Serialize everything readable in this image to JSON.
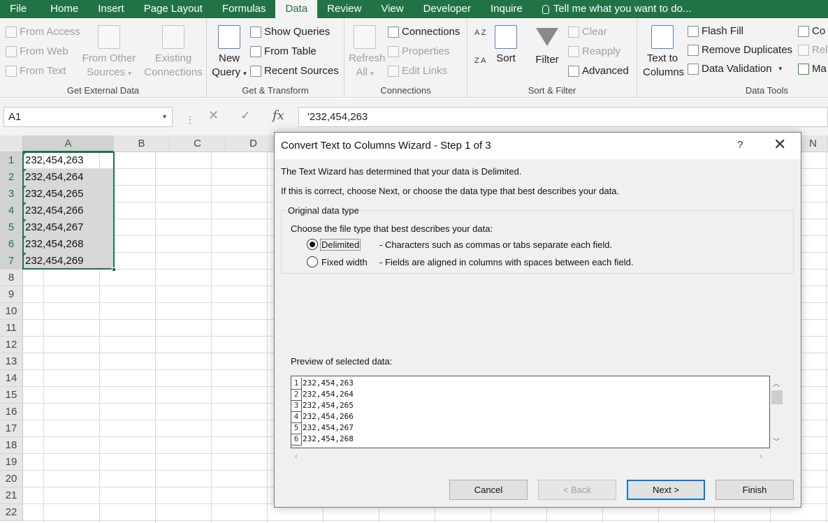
{
  "menu": {
    "items": [
      "File",
      "Home",
      "Insert",
      "Page Layout",
      "Formulas",
      "Data",
      "Review",
      "View",
      "Developer",
      "Inquire"
    ],
    "active": "Data",
    "tell_me": "Tell me what you want to do..."
  },
  "ribbon": {
    "get_external_data": {
      "label": "Get External Data",
      "from_access": "From Access",
      "from_web": "From Web",
      "from_text": "From Text",
      "from_other_sources_1": "From Other",
      "from_other_sources_2": "Sources",
      "existing_connections_1": "Existing",
      "existing_connections_2": "Connections"
    },
    "get_transform": {
      "label": "Get & Transform",
      "new_query_1": "New",
      "new_query_2": "Query",
      "show_queries": "Show Queries",
      "from_table": "From Table",
      "recent_sources": "Recent Sources"
    },
    "connections": {
      "label": "Connections",
      "refresh_1": "Refresh",
      "refresh_2": "All",
      "connections": "Connections",
      "properties": "Properties",
      "edit_links": "Edit Links"
    },
    "sort_filter": {
      "label": "Sort & Filter",
      "sort": "Sort",
      "filter": "Filter",
      "clear": "Clear",
      "reapply": "Reapply",
      "advanced": "Advanced",
      "az_icon": "A Z",
      "za_icon": "Z A"
    },
    "data_tools": {
      "label": "Data Tools",
      "text_to_columns_1": "Text to",
      "text_to_columns_2": "Columns",
      "flash_fill": "Flash Fill",
      "remove_duplicates": "Remove Duplicates",
      "data_validation": "Data Validation",
      "consolidate_partial": "Co",
      "relationships_partial": "Rel",
      "manage_partial": "Ma"
    }
  },
  "formula_bar": {
    "name_box": "A1",
    "fx": "fx",
    "content": "'232,454,263"
  },
  "sheet": {
    "columns": [
      "A",
      "B",
      "C",
      "D",
      "N"
    ],
    "rows": [
      "1",
      "2",
      "3",
      "4",
      "5",
      "6",
      "7",
      "8",
      "9",
      "10",
      "11",
      "12",
      "13",
      "14",
      "15",
      "16",
      "17",
      "18",
      "19",
      "20",
      "21",
      "22"
    ],
    "column_a": [
      "232,454,263",
      "232,454,264",
      "232,454,265",
      "232,454,266",
      "232,454,267",
      "232,454,268",
      "232,454,269"
    ]
  },
  "dialog": {
    "title": "Convert Text to Columns Wizard - Step 1 of 3",
    "help": "?",
    "line1": "The Text Wizard has determined that your data is Delimited.",
    "line2": "If this is correct, choose Next, or choose the data type that best describes your data.",
    "group_label": "Original data type",
    "choose_label": "Choose the file type that best describes your data:",
    "options": [
      {
        "label": "Delimited",
        "desc": "- Characters such as commas or tabs separate each field.",
        "selected": true
      },
      {
        "label": "Fixed width",
        "desc": "- Fields are aligned in columns with spaces between each field.",
        "selected": false
      }
    ],
    "preview_label": "Preview of selected data:",
    "preview_rows": [
      {
        "n": "1",
        "v": "232,454,263"
      },
      {
        "n": "2",
        "v": "232,454,264"
      },
      {
        "n": "3",
        "v": "232,454,265"
      },
      {
        "n": "4",
        "v": "232,454,266"
      },
      {
        "n": "5",
        "v": "232,454,267"
      },
      {
        "n": "6",
        "v": "232,454,268"
      }
    ],
    "buttons": {
      "cancel": "Cancel",
      "back": "< Back",
      "next": "Next >",
      "finish": "Finish"
    }
  },
  "colors": {
    "excel_green": "#217346",
    "selection_shade": "#d8d8d8",
    "default_button_border": "#0078d7"
  }
}
